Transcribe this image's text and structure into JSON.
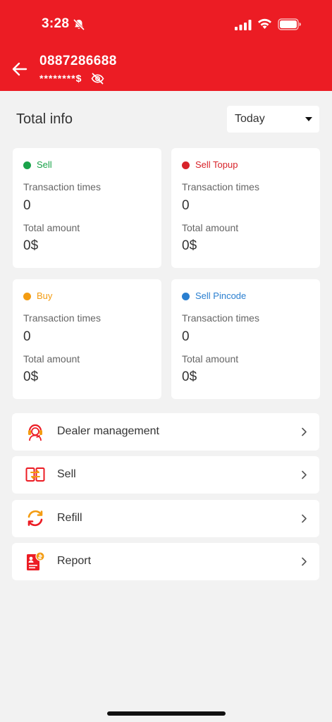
{
  "status_bar": {
    "time": "3:28",
    "icons": [
      "bell-muted-icon",
      "signal-icon",
      "wifi-icon",
      "battery-icon"
    ]
  },
  "header": {
    "account_number": "0887286688",
    "balance_masked": "********$",
    "back_icon": "arrow-left-icon",
    "visibility_icon": "eye-off-icon",
    "color": "#ec1c24"
  },
  "summary": {
    "title": "Total info",
    "period": "Today"
  },
  "cards": [
    {
      "title": "Sell",
      "color": "#1aa34a",
      "times_label": "Transaction times",
      "times": "0",
      "amount_label": "Total amount",
      "amount": "0$"
    },
    {
      "title": "Sell Topup",
      "color": "#d8232a",
      "times_label": "Transaction times",
      "times": "0",
      "amount_label": "Total amount",
      "amount": "0$"
    },
    {
      "title": "Buy",
      "color": "#f39c12",
      "times_label": "Transaction times",
      "times": "0",
      "amount_label": "Total amount",
      "amount": "0$"
    },
    {
      "title": "Sell Pincode",
      "color": "#2a7fd0",
      "times_label": "Transaction times",
      "times": "0",
      "amount_label": "Total amount",
      "amount": "0$"
    }
  ],
  "menu": [
    {
      "label": "Dealer management",
      "icon": "dealer-headset-icon"
    },
    {
      "label": "Sell",
      "icon": "sell-exchange-icon"
    },
    {
      "label": "Refill",
      "icon": "refill-cycle-icon"
    },
    {
      "label": "Report",
      "icon": "report-document-icon"
    }
  ]
}
